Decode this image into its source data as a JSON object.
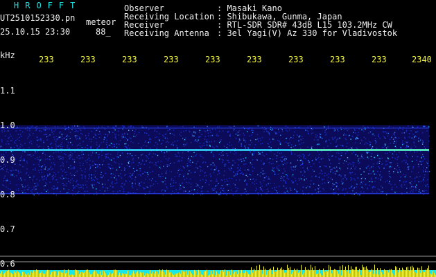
{
  "header": {
    "title": "HROFFT",
    "filename": "UT2510152330.pn",
    "meteor_label": "meteor",
    "datetime": "25.10.15 23:30",
    "count": "88_"
  },
  "meta": [
    {
      "key": "Observer",
      "value": ": Masaki Kano"
    },
    {
      "key": "Receiving Location",
      "value": ": Shibukawa, Gunma, Japan"
    },
    {
      "key": "Receiver",
      "value": ": RTL-SDR SDR# 43dB L15 103.2MHz CW"
    },
    {
      "key": "Receiving Antenna",
      "value": ": 3el Yagi(V) Az 330 for Vladivostok"
    }
  ],
  "axis": {
    "unit": "kHz",
    "ticks": [
      {
        "label": "1.1",
        "value": 1.1
      },
      {
        "label": "1.0",
        "value": 1.0
      },
      {
        "label": "0.9",
        "value": 0.9
      },
      {
        "label": "0.8",
        "value": 0.8
      },
      {
        "label": "0.7",
        "value": 0.7
      },
      {
        "label": "0.6",
        "value": 0.6
      }
    ],
    "range": [
      0.6,
      1.15
    ]
  },
  "time_labels": [
    "233",
    "233",
    "233",
    "233",
    "233",
    "233",
    "233",
    "233",
    "233",
    "2340"
  ],
  "colors": {
    "background": "#000000",
    "title": "#19e6e6",
    "text": "#f0f0f0",
    "time_labels": "#f2f23a",
    "signal_line": "#33ddff",
    "bottom_bar": "#19e6e6",
    "bottom_spikes": "#f2f23a"
  }
}
